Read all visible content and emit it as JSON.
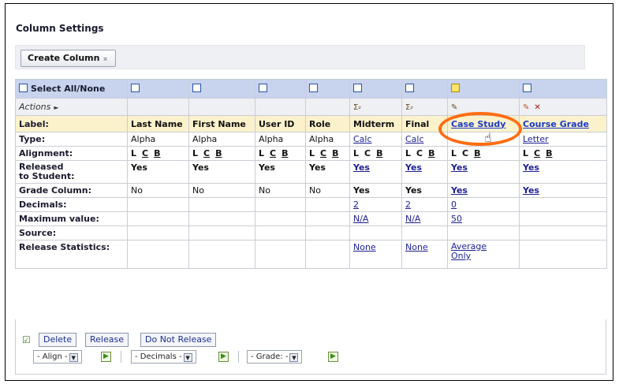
{
  "title": "Column Settings",
  "toolbar": {
    "create_column_label": "Create Column",
    "pin_glyph": "⌅"
  },
  "select_all_label": "Select All/None",
  "actions_label": "Actions",
  "row_headers": {
    "label": "Label:",
    "type": "Type:",
    "alignment": "Alignment:",
    "released_line1": "Released",
    "released_line2": "to Student:",
    "grade_column": "Grade Column:",
    "decimals": "Decimals:",
    "maximum_value": "Maximum value:",
    "source": "Source:",
    "release_statistics": "Release Statistics:"
  },
  "alignment_letters": {
    "left": "L",
    "center": "C",
    "right": "B"
  },
  "columns": [
    {
      "label": "Last Name",
      "type": "Alpha",
      "released": "Yes",
      "grade": "No",
      "decimals": "",
      "max": "",
      "stats_line1": "",
      "stats_line2": ""
    },
    {
      "label": "First Name",
      "type": "Alpha",
      "released": "Yes",
      "grade": "No",
      "decimals": "",
      "max": "",
      "stats_line1": "",
      "stats_line2": ""
    },
    {
      "label": "User ID",
      "type": "Alpha",
      "released": "Yes",
      "grade": "No",
      "decimals": "",
      "max": "",
      "stats_line1": "",
      "stats_line2": ""
    },
    {
      "label": "Role",
      "type": "Alpha",
      "released": "Yes",
      "grade": "No",
      "decimals": "",
      "max": "",
      "stats_line1": "",
      "stats_line2": ""
    },
    {
      "label": "Midterm",
      "type": "Calc",
      "released": "Yes",
      "grade": "Yes",
      "decimals": "2",
      "max": "N/A",
      "stats_line1": "None",
      "stats_line2": ""
    },
    {
      "label": "Final",
      "type": "Calc",
      "released": "Yes",
      "grade": "Yes",
      "decimals": "2",
      "max": "N/A",
      "stats_line1": "None",
      "stats_line2": ""
    },
    {
      "label": "Case Study",
      "type": "",
      "released": "Yes",
      "grade": "Yes",
      "decimals": "0",
      "max": "50",
      "stats_line1": "Average",
      "stats_line2": "Only"
    },
    {
      "label": "Course Grade",
      "type": "Letter",
      "released": "Yes",
      "grade": "Yes",
      "decimals": "",
      "max": "",
      "stats_line1": "",
      "stats_line2": ""
    }
  ],
  "footer": {
    "delete_label": "Delete",
    "release_label": "Release",
    "do_not_release_label": "Do Not Release",
    "align_select": "- Align -",
    "decimals_select": "- Decimals -",
    "grade_select": "- Grade: -"
  },
  "colors": {
    "header_blue": "#c8d4ee",
    "label_yellow": "#fbf2cc",
    "highlight_orange": "#ff6d12",
    "link_blue": "#1a3ac8"
  }
}
